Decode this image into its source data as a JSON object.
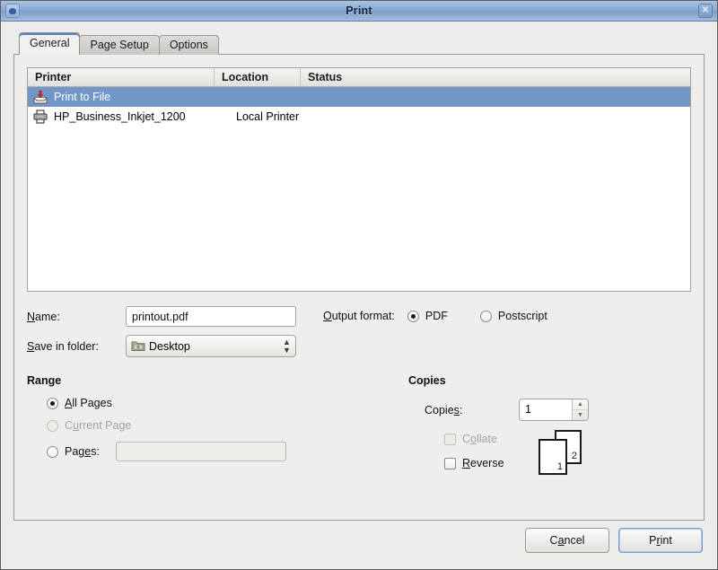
{
  "window": {
    "title": "Print",
    "icon": "app-icon",
    "close_label": "✕"
  },
  "tabs": [
    {
      "label": "General",
      "active": true
    },
    {
      "label": "Page Setup",
      "active": false
    },
    {
      "label": "Options",
      "active": false
    }
  ],
  "printer_list": {
    "columns": [
      "Printer",
      "Location",
      "Status"
    ],
    "rows": [
      {
        "icon": "print-to-file-icon",
        "printer": "Print to File",
        "location": "",
        "status": "",
        "selected": true
      },
      {
        "icon": "printer-icon",
        "printer": "HP_Business_Inkjet_1200",
        "location": "Local Printer",
        "status": "",
        "selected": false
      }
    ]
  },
  "file_fields": {
    "name_label_pre": "N",
    "name_label_mnemonic": "N",
    "name_label_rest": "ame:",
    "name_label": "Name:",
    "name_value": "printout.pdf",
    "folder_label": "Save in folder:",
    "folder_label_mnemonic": "S",
    "folder_label_rest": "ave in folder:",
    "folder_value": "Desktop",
    "folder_icon": "folder-icon",
    "chevron": "↕"
  },
  "output_format": {
    "label": "Output format:",
    "label_mnemonic": "O",
    "label_rest": "utput format:",
    "options": [
      {
        "label": "PDF",
        "selected": true
      },
      {
        "label": "Postscript",
        "selected": false
      }
    ]
  },
  "range": {
    "title": "Range",
    "options": [
      {
        "label": "All Pages",
        "selected": true,
        "disabled": false,
        "mnemonic": "A",
        "rest": "ll Pages"
      },
      {
        "label": "Current Page",
        "selected": false,
        "disabled": true,
        "mnemonic": "u",
        "pre": "C",
        "rest": "rrent Page"
      },
      {
        "label": "Pages:",
        "selected": false,
        "disabled": false,
        "mnemonic": "e",
        "pre": "Pag",
        "rest": "s:"
      }
    ],
    "pages_value": "",
    "pages_placeholder": ""
  },
  "copies": {
    "title": "Copies",
    "copies_label": "Copies:",
    "copies_label_pre": "Copie",
    "copies_label_mnemonic": "s",
    "copies_label_rest": ":",
    "copies_value": "1",
    "spin_up": "▲",
    "spin_down": "▼",
    "collate": {
      "label": "Collate",
      "checked": false,
      "disabled": true,
      "pre": "C",
      "mnemonic": "o",
      "rest": "llate"
    },
    "reverse": {
      "label": "Reverse",
      "checked": false,
      "disabled": false,
      "pre": "",
      "mnemonic": "R",
      "rest": "everse"
    },
    "preview": {
      "back_page": "2",
      "front_page": "1"
    }
  },
  "buttons": [
    {
      "label": "Cancel",
      "pre": "C",
      "mnemonic": "a",
      "rest": "ncel",
      "default": false
    },
    {
      "label": "Print",
      "pre": "P",
      "mnemonic": "r",
      "rest": "int",
      "default": true
    }
  ],
  "colors": {
    "selection_blue": "#7396c9",
    "titlebar_blue": "#89a9d3",
    "dialog_bg": "#efeeec",
    "disabled_text": "#a6a49f",
    "accent_tab": "#5a86c4"
  }
}
